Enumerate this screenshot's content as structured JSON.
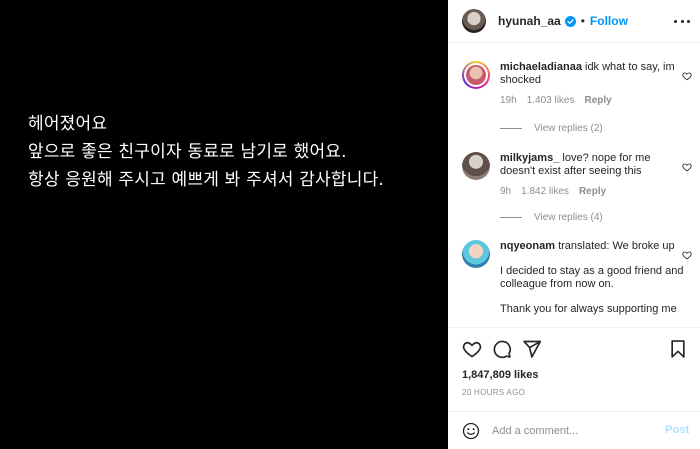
{
  "post_image": {
    "lines": [
      "헤어졌어요",
      "앞으로 좋은 친구이자 동료로 남기로 했어요.",
      "항상 응원해 주시고 예쁘게 봐 주셔서 감사합니다."
    ]
  },
  "header": {
    "username": "hyunah_aa",
    "separator": "•",
    "follow_label": "Follow"
  },
  "comments": [
    {
      "username": "michaeladianaa",
      "text": "idk what to say, im shocked",
      "time": "19h",
      "likes": "1.403 likes",
      "reply_label": "Reply",
      "view_replies": "View replies (2)"
    },
    {
      "username": "milkyjams_",
      "text": "love? nope for me doesn't exist after seeing this",
      "time": "9h",
      "likes": "1.842 likes",
      "reply_label": "Reply",
      "view_replies": "View replies (4)"
    },
    {
      "username": "nqyeonam",
      "text": "translated: We broke up",
      "extra_1": "I decided to stay as a good friend and colleague from now on.",
      "extra_2": "Thank you for always supporting me"
    }
  ],
  "stats": {
    "likes": "1,847,809 likes",
    "time_ago": "20 HOURS AGO"
  },
  "add_comment": {
    "placeholder": "Add a comment...",
    "post_label": "Post"
  },
  "colors": {
    "accent": "#0095f6",
    "post_disabled": "#b2dffc",
    "secondary_text": "#8e8e8e"
  }
}
